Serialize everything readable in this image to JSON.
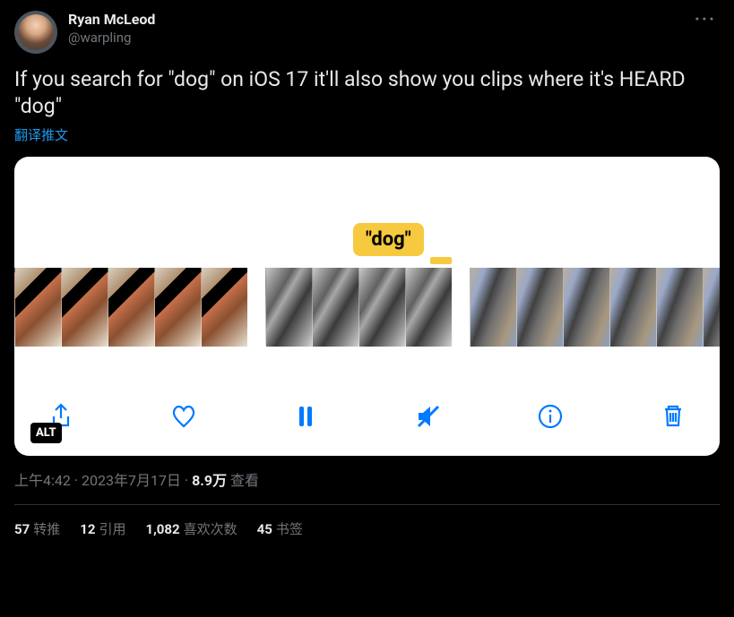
{
  "user": {
    "displayName": "Ryan McLeod",
    "handle": "@warpling"
  },
  "tweet": {
    "text": "If you search for \"dog\" on iOS 17 it'll also show you clips where it's HEARD \"dog\"",
    "translateLabel": "翻译推文"
  },
  "media": {
    "tooltipText": "\"dog\"",
    "altBadge": "ALT"
  },
  "meta": {
    "time": "上午4:42",
    "date": "2023年7月17日",
    "viewsCount": "8.9万",
    "viewsLabel": "查看"
  },
  "stats": {
    "retweets": {
      "count": "57",
      "label": "转推"
    },
    "quotes": {
      "count": "12",
      "label": "引用"
    },
    "likes": {
      "count": "1,082",
      "label": "喜欢次数"
    },
    "bookmarks": {
      "count": "45",
      "label": "书签"
    }
  }
}
